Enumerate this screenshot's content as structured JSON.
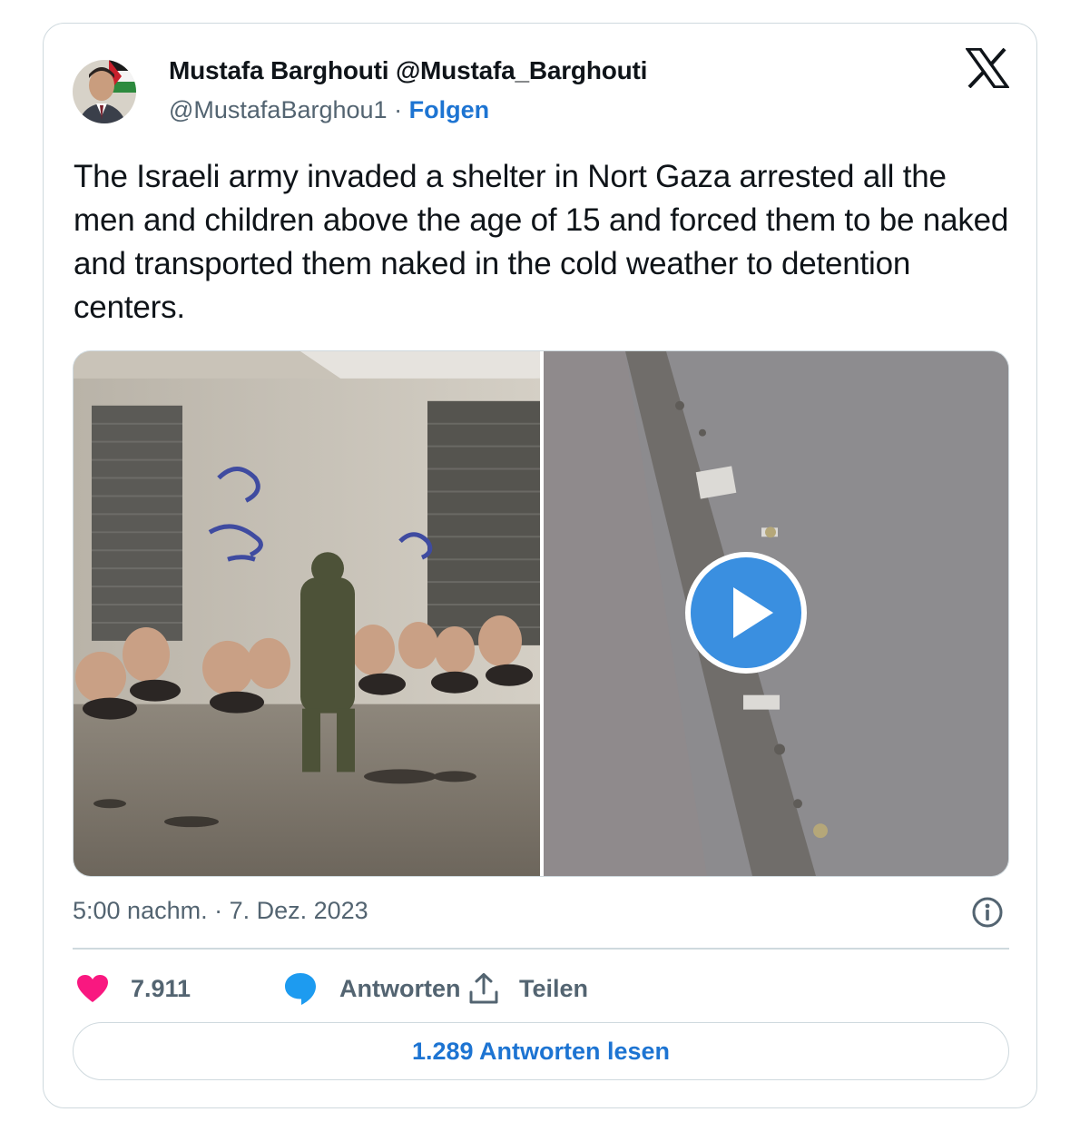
{
  "author": {
    "display_name": "Mustafa Barghouti @Mustafa_Barghouti",
    "handle": "@MustafaBarghou1",
    "separator": "·",
    "follow_label": "Folgen"
  },
  "tweet": {
    "text": "The Israeli army invaded a shelter in Nort Gaza arrested all the men and children above the age of 15 and forced them to be naked and transported them naked in the cold weather to detention centers."
  },
  "meta": {
    "timestamp": "5:00 nachm. · 7. Dez. 2023"
  },
  "actions": {
    "likes": "7.911",
    "reply_label": "Antworten",
    "share_label": "Teilen"
  },
  "read_replies_label": "1.289 Antworten lesen",
  "icons": {
    "logo": "x-logo-icon",
    "info": "info-icon",
    "like": "heart-icon",
    "reply": "speech-bubble-icon",
    "share": "share-upload-icon",
    "play": "play-icon"
  },
  "colors": {
    "link": "#1d74d2",
    "heart": "#f91880",
    "reply_bubble": "#1d9bf0",
    "play_button": "#3a8fe0",
    "muted_text": "#536471",
    "border": "#cfd9de"
  }
}
